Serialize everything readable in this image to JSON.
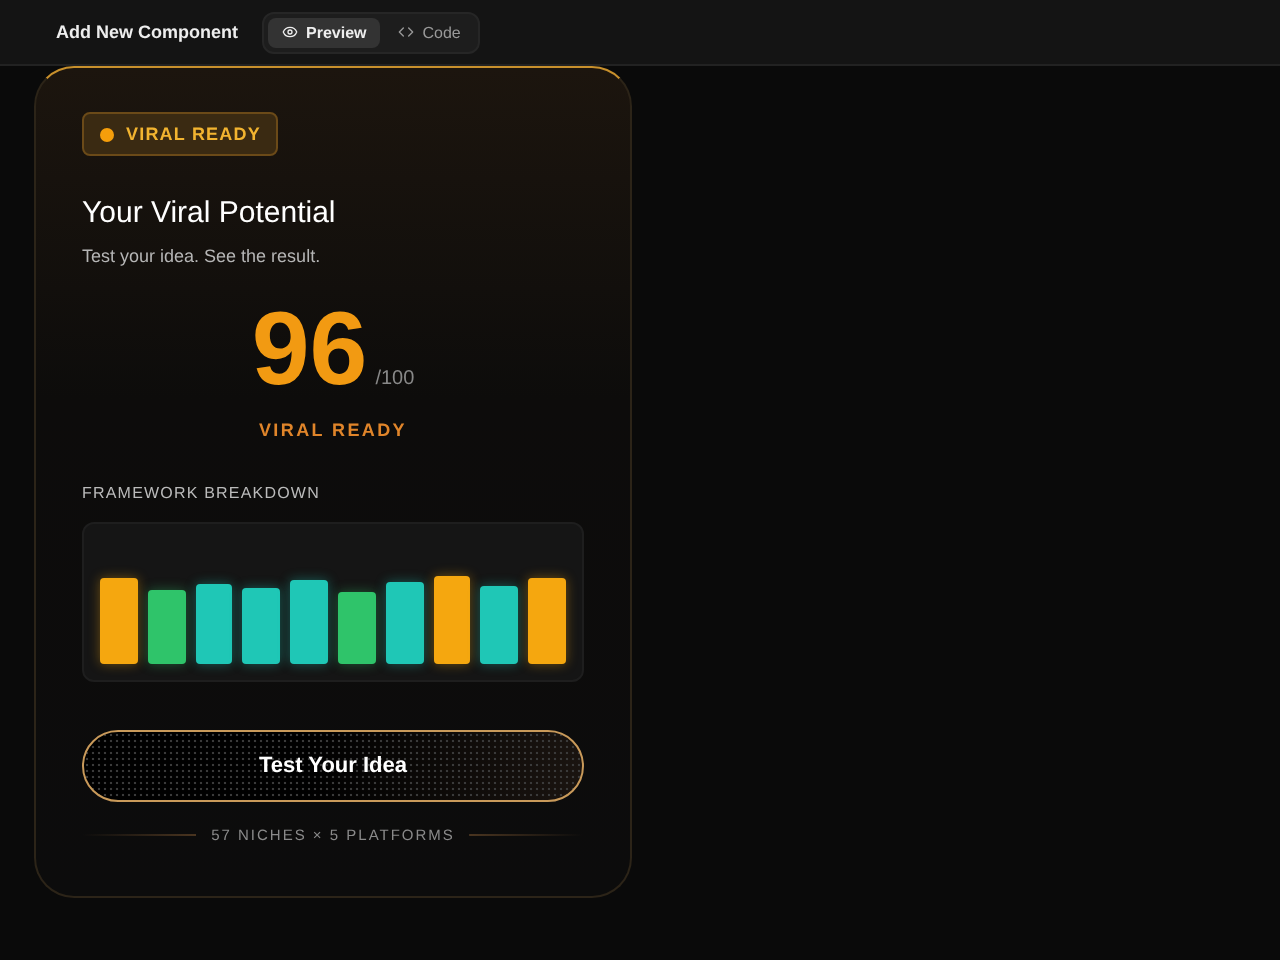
{
  "header": {
    "title": "Add New Component",
    "tabs": [
      {
        "label": "Preview",
        "selected": true
      },
      {
        "label": "Code",
        "selected": false
      }
    ]
  },
  "card": {
    "badge": {
      "label": "VIRAL READY",
      "color": "#f59e0b"
    },
    "title": "Your Viral Potential",
    "subtitle": "Test your idea. See the result.",
    "score": "96",
    "score_max": "/100",
    "score_label": "VIRAL READY",
    "breakdown_title": "FRAMEWORK BREAKDOWN",
    "bars": [
      {
        "color": "#f5a70f"
      },
      {
        "color": "#2fc46a"
      },
      {
        "color": "#1fc7b6"
      },
      {
        "color": "#1fc7b6"
      },
      {
        "color": "#1fc7b6"
      },
      {
        "color": "#2fc46a"
      },
      {
        "color": "#1fc7b6"
      },
      {
        "color": "#f5a70f"
      },
      {
        "color": "#1fc7b6"
      },
      {
        "color": "#f5a70f"
      }
    ],
    "button": "Test Your Idea",
    "footer": "57 NICHES × 5 PLATFORMS"
  }
}
